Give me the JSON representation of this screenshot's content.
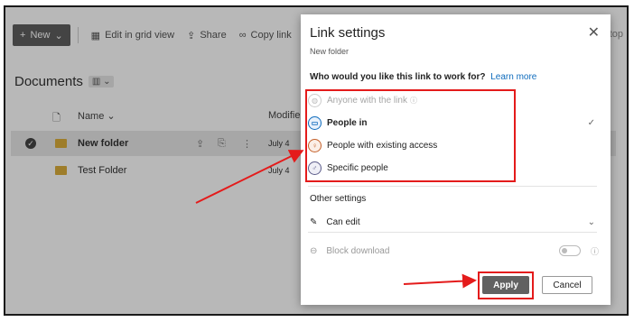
{
  "toolbar": {
    "new_label": "New",
    "grid_label": "Edit in grid view",
    "share_label": "Share",
    "copy_link_label": "Copy link",
    "topright_label": "top"
  },
  "library": {
    "title": "Documents",
    "columns": {
      "name": "Name",
      "modified": "Modifie"
    },
    "rows": [
      {
        "name": "New folder",
        "modified": "July 4"
      },
      {
        "name": "Test Folder",
        "modified": "July 4"
      }
    ]
  },
  "dialog": {
    "title": "Link settings",
    "subtitle": "New folder",
    "question": "Who would you like this link to work for?",
    "learn_more": "Learn more",
    "options": [
      {
        "label": "Anyone with the link",
        "state": "disabled",
        "icon": "globe-icon"
      },
      {
        "label": "People in",
        "state": "selected",
        "icon": "building-icon"
      },
      {
        "label": "People with existing access",
        "state": "normal",
        "icon": "people-icon"
      },
      {
        "label": "Specific people",
        "state": "normal",
        "icon": "person-icon"
      }
    ],
    "other_settings": "Other settings",
    "permission": "Can edit",
    "block_download": "Block download",
    "apply_label": "Apply",
    "cancel_label": "Cancel"
  },
  "colors": {
    "accent": "#0f6cbd",
    "highlight": "#e41b1b",
    "apply_bg": "#616161",
    "folder": "#dcae3b"
  }
}
